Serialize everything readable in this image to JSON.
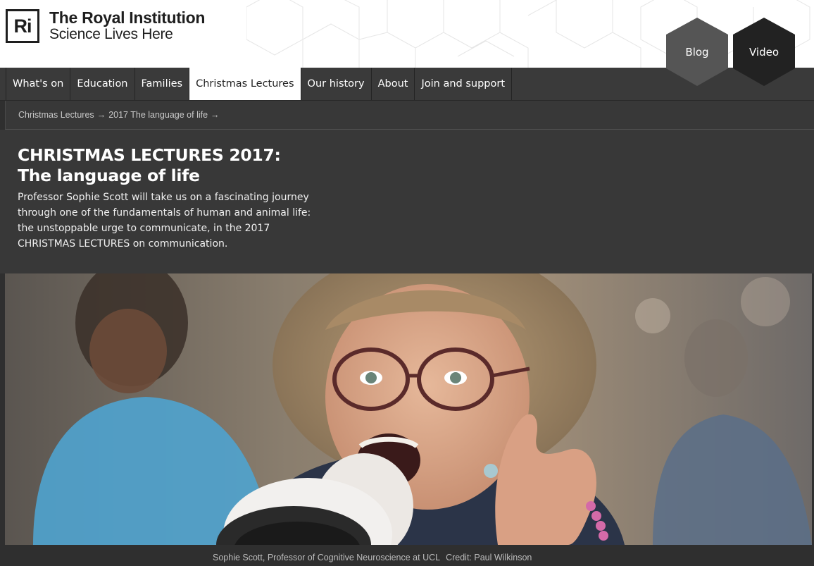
{
  "brand": {
    "mark": "Ri",
    "title": "The Royal Institution",
    "tagline": "Science Lives Here"
  },
  "header_links": {
    "blog": "Blog",
    "video": "Video"
  },
  "nav": {
    "items": [
      {
        "label": "What's on",
        "active": false
      },
      {
        "label": "Education",
        "active": false
      },
      {
        "label": "Families",
        "active": false
      },
      {
        "label": "Christmas Lectures",
        "active": true
      },
      {
        "label": "Our history",
        "active": false
      },
      {
        "label": "About",
        "active": false
      },
      {
        "label": "Join and support",
        "active": false
      }
    ]
  },
  "breadcrumb": {
    "items": [
      "Christmas Lectures",
      "2017 The language of life"
    ],
    "separator": "→"
  },
  "intro": {
    "title": "CHRISTMAS LECTURES 2017: The language of life",
    "description": "Professor Sophie Scott will take us on a fascinating journey through one of the fundamentals of human and animal life: the unstoppable urge to communicate, in the 2017 CHRISTMAS LECTURES on communication."
  },
  "hero": {
    "caption": "Sophie Scott, Professor of Cognitive Neuroscience at UCL",
    "credit": "Credit: Paul Wilkinson"
  },
  "colors": {
    "page_background": "#2f2f2f",
    "panel": "#383838",
    "nav_background": "#3a3a3a",
    "hex_blog": "#555555",
    "hex_video": "#222222"
  },
  "icons": {
    "breadcrumb_separator": "right-arrow-icon",
    "blog": "hexagon-icon",
    "video": "hexagon-icon"
  }
}
